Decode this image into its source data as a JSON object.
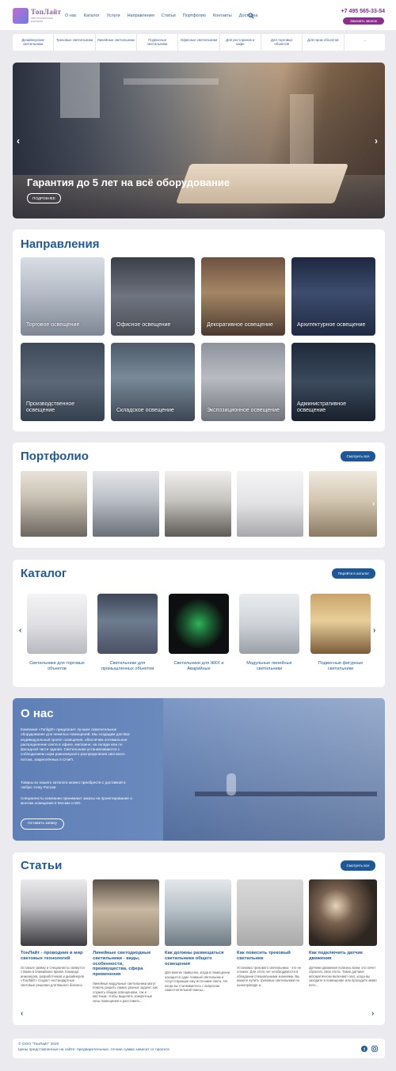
{
  "header": {
    "logo_text": "ТопЛайт",
    "logo_sub": "светотехническая компания",
    "nav": [
      "О нас",
      "Каталог",
      "Услуги",
      "Направления",
      "Статьи",
      "Портфолио",
      "Контакты",
      "Доставка"
    ],
    "phone": "+7 495 565-33-54",
    "call_button": "Заказать звонок"
  },
  "catbar": [
    "Дизайнерские светильники",
    "Трековые светильники",
    "Линейные светильники",
    "Подвесные светильники",
    "Офисные светильники",
    "Для ресторанов и кафе",
    "Для торговых объектов",
    "Для пром объектов",
    "..."
  ],
  "hero": {
    "title": "Гарантия до 5 лет на всё оборудование",
    "button": "ПОДРОБНЕЕ"
  },
  "directions": {
    "title": "Направления",
    "items": [
      "Торговое освещение",
      "Офисное освещение",
      "Декоративное освещение",
      "Архитектурное освещение",
      "Производственное освещение",
      "Складское освещение",
      "Экспозиционное освещение",
      "Административное освещение"
    ]
  },
  "portfolio": {
    "title": "Портфолио",
    "button": "Смотреть все"
  },
  "catalog": {
    "title": "Каталог",
    "button": "Перейти в каталог",
    "items": [
      "Светильники для торговых объектов",
      "Светильники для промышленных объектов",
      "Светильники для ЖКХ и Аварийные",
      "Модульные линейные светильники",
      "Подвесные фигурные светильники"
    ]
  },
  "about": {
    "title": "О нас",
    "p1": "Компания «Tonlight» предлагает лучшее осветительное оборудование для нежилых помещений. Мы создадим для Вас индивидуальный проект освещения, обеспечим оптимальное распределение света в офисе, магазине, на складе или по фасадной части здания. Светильники устанавливаются с соблюдением норм равномерного распределения светового потока, закреплённых в СНиП.",
    "p2": "Товары из нашего каталога можно приобрести с доставкой в любую точку России.",
    "p3": "Специалисты компании принимают заказы на проектирование и монтаж освещения в Москве и МО.",
    "button": "Оставить заявку"
  },
  "articles": {
    "title": "Статьи",
    "button": "Смотреть все",
    "items": [
      {
        "title": "ТонЛайт - проводник в мир световых технологий",
        "desc": "Оставьте заявку и специалисты свяжутся с Вами в ближайшее время. Команда инженеров, разработчиков и дизайнеров «ТонЛайт» создаст нестандартные световые решения для Вашего бизнеса."
      },
      {
        "title": "Линейные светодиодные светильники - виды, особенности, преимущества, сфера применения",
        "desc": "Линейные модульные светильники могут помочь решить самые разные задачи: как служить общим освещением, так и местным, чтобы выделить конкретные зоны помещения и расставить..."
      },
      {
        "title": "Как должны размещаться светильники общего освещения",
        "desc": "Для многих привычно, когда в помещении находится один главный светильник и сопутствующие ему источники света. Но когда вы сталкиваетесь с вопросом самостоятельной смены..."
      },
      {
        "title": "Как повесить трековый светильник",
        "desc": "Установка трекового светильника - это не сложно. Для этого нет необходимости в обладании специальными знаниями. Вы можете купить трековые светильники на шинопроводе и..."
      },
      {
        "title": "Как подключить датчик движения",
        "desc": "Датчики движения полезны всем, кто хочет сбросить свои счета. Такие датчики автоматически включают свет, когда вы заходите в помещение или проходите мимо него..."
      }
    ]
  },
  "footer": {
    "copyright": "© ООО \"ТонЛайт\" 2020",
    "note": "Цены представленные на сайте: предварительные, точная сумма зависит от проекта"
  },
  "colors": {
    "brand_blue": "#1f5a95",
    "brand_purple": "#8a2f8e",
    "background": "#ebebef"
  }
}
